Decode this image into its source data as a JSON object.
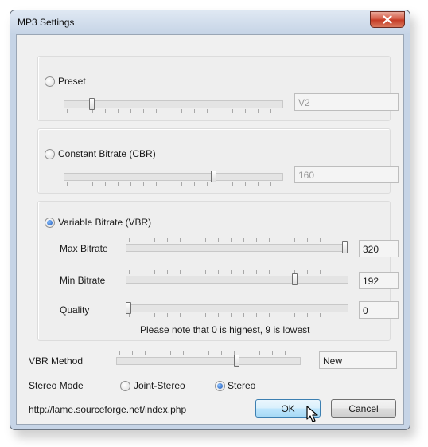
{
  "window": {
    "title": "MP3 Settings"
  },
  "preset": {
    "label": "Preset",
    "selected": false,
    "slider_fraction": 0.12,
    "value": "V2"
  },
  "cbr": {
    "label": "Constant Bitrate (CBR)",
    "selected": false,
    "slider_fraction": 0.69,
    "value": "160"
  },
  "vbr": {
    "label": "Variable Bitrate (VBR)",
    "selected": true,
    "max_bitrate": {
      "label": "Max Bitrate",
      "value": "320",
      "slider_fraction": 1.0
    },
    "min_bitrate": {
      "label": "Min Bitrate",
      "value": "192",
      "slider_fraction": 0.77
    },
    "quality": {
      "label": "Quality",
      "value": "0",
      "slider_fraction": 0.0
    },
    "note": "Please note that 0 is highest, 9 is lowest"
  },
  "vbr_method": {
    "label": "VBR Method",
    "value": "New",
    "slider_fraction": 0.66
  },
  "stereo_mode": {
    "label": "Stereo Mode",
    "options": [
      {
        "label": "Joint-Stereo",
        "selected": false
      },
      {
        "label": "Stereo",
        "selected": true
      }
    ]
  },
  "footer": {
    "link": "http://lame.sourceforge.net/index.php",
    "ok_label": "OK",
    "cancel_label": "Cancel"
  },
  "icons": {
    "close": "close-icon",
    "cursor": "mouse-pointer-icon"
  },
  "colors": {
    "accent": "#1a56b8",
    "close_button": "#c43a24",
    "default_button": "#3c7fb1"
  }
}
